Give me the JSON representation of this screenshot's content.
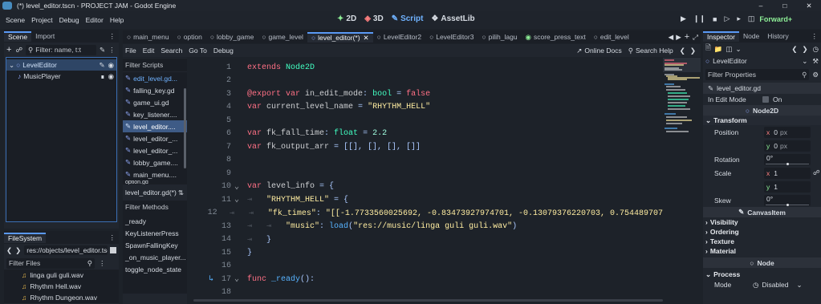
{
  "window": {
    "title": "(*) level_editor.tscn - PROJECT JAM - Godot Engine"
  },
  "menu": [
    "Scene",
    "Project",
    "Debug",
    "Editor",
    "Help"
  ],
  "workspaces": {
    "w2d": "2D",
    "w3d": "3D",
    "script": "Script",
    "assetlib": "AssetLib"
  },
  "renderer": "Forward+",
  "scene_dock": {
    "tab_scene": "Scene",
    "tab_import": "Import",
    "filter_placeholder": "Filter: name, t:t",
    "nodes": [
      {
        "name": "LevelEditor"
      },
      {
        "name": "MusicPlayer"
      }
    ]
  },
  "filesystem": {
    "title": "FileSystem",
    "path": "res://objects/level_editor.tsc",
    "filter_placeholder": "Filter Files",
    "files": [
      "linga guli guli.wav",
      "Rhythm Hell.wav",
      "Rhythm Dungeon.wav"
    ]
  },
  "editor_tabs": [
    "main_menu",
    "option",
    "lobby_game",
    "game_level",
    "level_editor(*)",
    "LevelEditor2",
    "LevelEditor3",
    "pilih_lagu",
    "score_press_text",
    "edit_level"
  ],
  "script_menu": {
    "file": "File",
    "edit": "Edit",
    "search": "Search",
    "goto": "Go To",
    "debug": "Debug",
    "online_docs": "Online Docs",
    "search_help": "Search Help"
  },
  "scripts_panel": {
    "filter_placeholder": "Filter Scripts",
    "items": [
      "edit_level.gd...",
      "falling_key.gd",
      "game_ui.gd",
      "key_listener....",
      "level_editor....",
      "level_editor_...",
      "level_editor_...",
      "lobby_game....",
      "main_menu....",
      "option.gd"
    ],
    "current": "level_editor.gd(*)",
    "methods_placeholder": "Filter Methods",
    "methods": [
      "_ready",
      "KeyListenerPress",
      "SpawnFallingKey",
      "_on_music_player...",
      "toggle_node_state"
    ]
  },
  "code_lines": [
    {
      "n": "1",
      "t": [
        [
          "kw",
          "extends "
        ],
        [
          "cls",
          "Node2D"
        ]
      ]
    },
    {
      "n": "2",
      "t": []
    },
    {
      "n": "3",
      "t": [
        [
          "kw",
          "@export "
        ],
        [
          "kw",
          "var "
        ],
        [
          "ident",
          "in_edit_mode"
        ],
        [
          "op",
          ": "
        ],
        [
          "cls",
          "bool"
        ],
        [
          "op",
          " = "
        ],
        [
          "kw",
          "false"
        ]
      ]
    },
    {
      "n": "4",
      "t": [
        [
          "kw",
          "var "
        ],
        [
          "ident",
          "current_level_name"
        ],
        [
          "op",
          " = "
        ],
        [
          "str",
          "\"RHYTHM_HELL\""
        ]
      ]
    },
    {
      "n": "5",
      "t": []
    },
    {
      "n": "6",
      "t": [
        [
          "kw",
          "var "
        ],
        [
          "ident",
          "fk_fall_time"
        ],
        [
          "op",
          ": "
        ],
        [
          "cls",
          "float"
        ],
        [
          "op",
          " = "
        ],
        [
          "num",
          "2.2"
        ]
      ]
    },
    {
      "n": "7",
      "t": [
        [
          "kw",
          "var "
        ],
        [
          "ident",
          "fk_output_arr"
        ],
        [
          "op",
          " = [[], [], [], []]"
        ]
      ]
    },
    {
      "n": "8",
      "t": []
    },
    {
      "n": "9",
      "t": []
    },
    {
      "n": "10",
      "t": [
        [
          "kw",
          "var "
        ],
        [
          "ident",
          "level_info"
        ],
        [
          "op",
          " = {"
        ]
      ]
    },
    {
      "n": "11",
      "t": [
        [
          "str",
          "\"RHYTHM_HELL\""
        ],
        [
          "op",
          " = {"
        ]
      ]
    },
    {
      "n": "12",
      "t": [
        [
          "str",
          "\"fk_times\""
        ],
        [
          "op",
          ": "
        ],
        [
          "str",
          "\"[[-1.7733560025692, -0.83473927974701, -0.13079376220703, 0.754489707"
        ]
      ]
    },
    {
      "n": "13",
      "t": [
        [
          "str",
          "\"music\""
        ],
        [
          "op",
          ": "
        ],
        [
          "fn",
          "load"
        ],
        [
          "op",
          "("
        ],
        [
          "str",
          "\"res://music/linga guli guli.wav\""
        ],
        [
          "op",
          ")"
        ]
      ]
    },
    {
      "n": "14",
      "t": [
        [
          "op",
          "}"
        ]
      ]
    },
    {
      "n": "15",
      "t": [
        [
          "op",
          "}"
        ]
      ]
    },
    {
      "n": "16",
      "t": []
    },
    {
      "n": "17",
      "t": [
        [
          "kw",
          "func "
        ],
        [
          "fn",
          "_ready"
        ],
        [
          "op",
          "():"
        ]
      ]
    },
    {
      "n": "18",
      "t": []
    }
  ],
  "inspector": {
    "tabs": [
      "Inspector",
      "Node",
      "History"
    ],
    "node_name": "LevelEditor",
    "filter_placeholder": "Filter Properties",
    "script": "level_editor.gd",
    "in_edit_mode_label": "In Edit Mode",
    "in_edit_mode_value": "On",
    "node2d": "Node2D",
    "transform": "Transform",
    "position_label": "Position",
    "pos_x": "0",
    "pos_y": "0",
    "px": "px",
    "rotation_label": "Rotation",
    "rotation": "0",
    "scale_label": "Scale",
    "scale_x": "1",
    "scale_y": "1",
    "skew_label": "Skew",
    "skew": "0",
    "canvasitem": "CanvasItem",
    "sections": [
      "Visibility",
      "Ordering",
      "Texture",
      "Material"
    ],
    "node": "Node",
    "process": "Process",
    "mode_label": "Mode",
    "mode_value": "Disabled"
  },
  "colors": {
    "accent": "#5a99f5",
    "keyword": "#ff7085",
    "class": "#42ffc2",
    "string": "#ffeda1"
  }
}
